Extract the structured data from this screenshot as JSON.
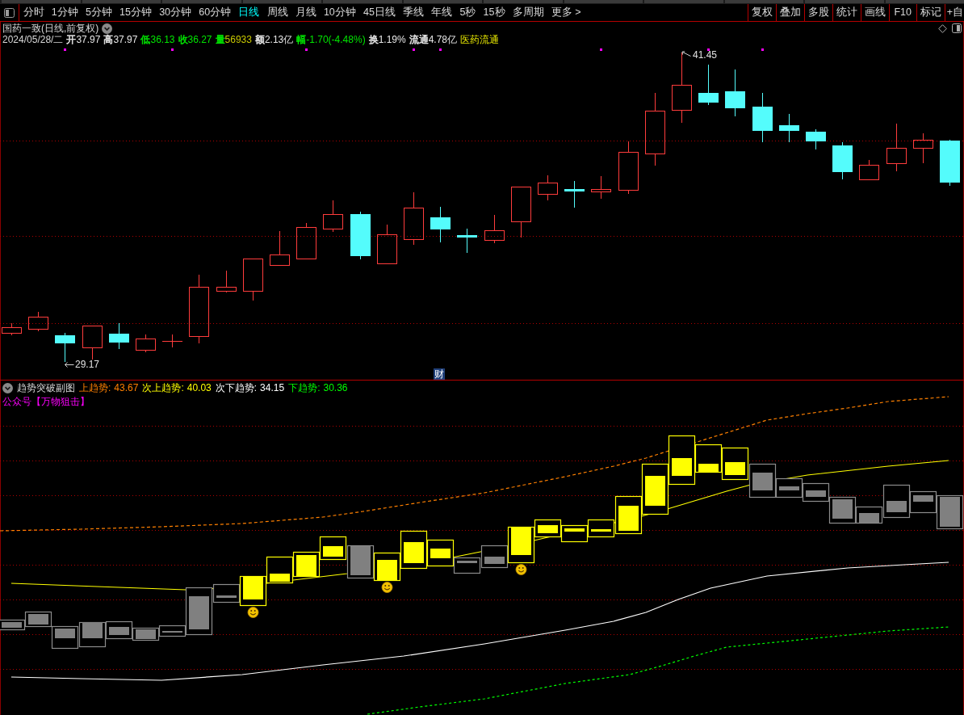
{
  "toolbar": {
    "periods": [
      {
        "label": "分时",
        "selected": false
      },
      {
        "label": "1分钟",
        "selected": false
      },
      {
        "label": "5分钟",
        "selected": false
      },
      {
        "label": "15分钟",
        "selected": false
      },
      {
        "label": "30分钟",
        "selected": false
      },
      {
        "label": "60分钟",
        "selected": false
      },
      {
        "label": "日线",
        "selected": true
      },
      {
        "label": "周线",
        "selected": false
      },
      {
        "label": "月线",
        "selected": false
      },
      {
        "label": "10分钟",
        "selected": false
      },
      {
        "label": "45日线",
        "selected": false
      },
      {
        "label": "季线",
        "selected": false
      },
      {
        "label": "年线",
        "selected": false
      },
      {
        "label": "5秒",
        "selected": false
      },
      {
        "label": "15秒",
        "selected": false
      },
      {
        "label": "多周期",
        "selected": false
      }
    ],
    "more": "更多 >",
    "tools": [
      "复权",
      "叠加",
      "多股",
      "统计",
      "画线",
      "F10",
      "标记",
      "+自"
    ]
  },
  "price_chart": {
    "title": "国药一致(日线,前复权)",
    "date": "2024/05/28/二",
    "stats": [
      {
        "label": {
          "text": "开",
          "color": "#e6e6e6"
        },
        "value": {
          "text": "37.97",
          "color": "#e6e6e6"
        }
      },
      {
        "label": {
          "text": "高",
          "color": "#e6e6e6"
        },
        "value": {
          "text": "37.97",
          "color": "#e6e6e6"
        }
      },
      {
        "label": {
          "text": "低",
          "color": "#00e600"
        },
        "value": {
          "text": "36.13",
          "color": "#00e600"
        }
      },
      {
        "label": {
          "text": "收",
          "color": "#00e600"
        },
        "value": {
          "text": "36.27",
          "color": "#00e600"
        }
      },
      {
        "label": {
          "text": "量",
          "color": "#00e600"
        },
        "value": {
          "text": "56933",
          "color": "#c8c800"
        }
      },
      {
        "label": {
          "text": "额",
          "color": "#e6e6e6"
        },
        "value": {
          "text": "2.13亿",
          "color": "#e6e6e6"
        }
      },
      {
        "label": {
          "text": "幅",
          "color": "#00e600"
        },
        "value": {
          "text": "-1.70(-4.48%)",
          "color": "#00e600"
        }
      },
      {
        "label": {
          "text": "换",
          "color": "#e6e6e6"
        },
        "value": {
          "text": "1.19%",
          "color": "#e6e6e6"
        }
      },
      {
        "label": {
          "text": "流通",
          "color": "#e6e6e6"
        },
        "value": {
          "text": "4.78亿",
          "color": "#e6e6e6"
        }
      }
    ],
    "sector": "医药流通",
    "high_label": "41.45",
    "low_label": "29.17",
    "marker": "财"
  },
  "indicator": {
    "name": "趋势突破副图",
    "values": [
      {
        "label": "上趋势:",
        "value": "43.67",
        "color": "#ff8000"
      },
      {
        "label": "次上趋势:",
        "value": "40.03",
        "color": "#ffff00"
      },
      {
        "label": "次下趋势:",
        "value": "34.15",
        "color": "#ffffff"
      },
      {
        "label": "下趋势:",
        "value": "30.36",
        "color": "#00ff00"
      }
    ],
    "note": "公众号【万物狙击】"
  }
}
